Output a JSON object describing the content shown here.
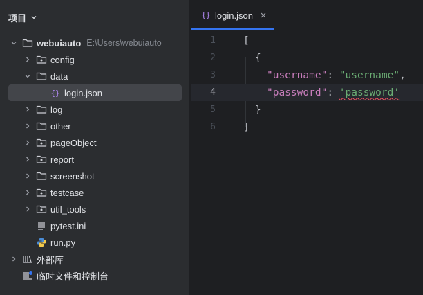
{
  "project_panel": {
    "title": "项目",
    "tree": [
      {
        "label": "webuiauto",
        "hint": "E:\\Users\\webuiauto",
        "kind": "root-folder",
        "expanded": true,
        "depth": 0
      },
      {
        "label": "config",
        "kind": "package-folder",
        "expanded": false,
        "depth": 1
      },
      {
        "label": "data",
        "kind": "folder",
        "expanded": true,
        "depth": 1
      },
      {
        "label": "login.json",
        "kind": "json-file",
        "depth": 2,
        "selected": true
      },
      {
        "label": "log",
        "kind": "folder",
        "expanded": false,
        "depth": 1
      },
      {
        "label": "other",
        "kind": "folder",
        "expanded": false,
        "depth": 1
      },
      {
        "label": "pageObject",
        "kind": "package-folder",
        "expanded": false,
        "depth": 1
      },
      {
        "label": "report",
        "kind": "package-folder",
        "expanded": false,
        "depth": 1
      },
      {
        "label": "screenshot",
        "kind": "folder",
        "expanded": false,
        "depth": 1
      },
      {
        "label": "testcase",
        "kind": "package-folder",
        "expanded": false,
        "depth": 1
      },
      {
        "label": "util_tools",
        "kind": "package-folder",
        "expanded": false,
        "depth": 1
      },
      {
        "label": "pytest.ini",
        "kind": "ini-file",
        "depth": 1
      },
      {
        "label": "run.py",
        "kind": "python-file",
        "depth": 1
      },
      {
        "label": "外部库",
        "kind": "library",
        "expanded": false,
        "depth": 0
      },
      {
        "label": "临时文件和控制台",
        "kind": "scratches",
        "depth": 0
      }
    ]
  },
  "editor": {
    "tab": {
      "label": "login.json",
      "icon": "json-braces-icon"
    },
    "line_numbers": [
      "1",
      "2",
      "3",
      "4",
      "5",
      "6"
    ],
    "current_line": 4,
    "lines": {
      "l1": "[",
      "l2": "{",
      "l3_key": "\"username\"",
      "l3_colon": ": ",
      "l3_val": "\"username\"",
      "l3_comma": ",",
      "l4_key": "\"password\"",
      "l4_colon": ": ",
      "l4_val": "'password'",
      "l5": "}",
      "l6": "]"
    }
  },
  "colors": {
    "sidebar_bg": "#2b2d30",
    "editor_bg": "#1e1f22",
    "selection": "#43454a",
    "accent": "#3574f0",
    "json_key": "#c77dbb",
    "json_string": "#6aab73",
    "error_underline": "#f75464"
  }
}
